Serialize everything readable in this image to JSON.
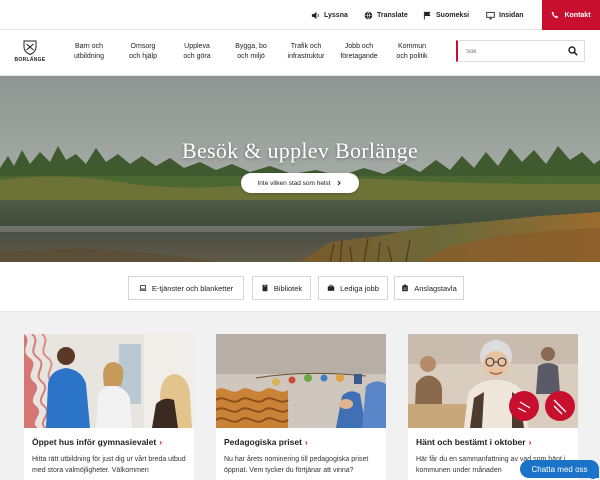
{
  "utility": {
    "listen": "Lyssna",
    "translate": "Translate",
    "finnish": "Suomeksi",
    "intranet": "Insidan",
    "contact": "Kontakt"
  },
  "brand": {
    "logo_text": "BORLÄNGE",
    "accent": "#c8102e"
  },
  "nav": [
    {
      "line1": "Barn och",
      "line2": "utbildning"
    },
    {
      "line1": "Omsorg",
      "line2": "och hjälp"
    },
    {
      "line1": "Uppleva",
      "line2": "och göra"
    },
    {
      "line1": "Bygga, bo",
      "line2": "och miljö"
    },
    {
      "line1": "Trafik och",
      "line2": "infrastruktur"
    },
    {
      "line1": "Jobb och",
      "line2": "företagande"
    },
    {
      "line1": "Kommun",
      "line2": "och politik"
    }
  ],
  "search": {
    "placeholder": "Sök"
  },
  "hero": {
    "title": "Besök & upplev Borlänge",
    "button": "Inte vilken stad som helst"
  },
  "quicklinks": [
    {
      "label": "E-tjänster och blanketter",
      "icon": "laptop-icon"
    },
    {
      "label": "Bibliotek",
      "icon": "book-icon"
    },
    {
      "label": "Lediga jobb",
      "icon": "briefcase-icon"
    },
    {
      "label": "Anslagstavla",
      "icon": "bulletin-icon"
    }
  ],
  "cards": [
    {
      "title": "Öppet hus inför gymnasievalet",
      "text": "Hitta rätt utbildning för just dig ur vårt breda utbud med stora valmöjligheter. Välkommen"
    },
    {
      "title": "Pedagogiska priset",
      "text": "Nu har årets nominering till pedagogiska priset öppnat. Vem tycker du förtjänar att vinna?"
    },
    {
      "title": "Hänt och bestämt i oktober",
      "text": "Här får du en sammanfattning av vad som hänt i kommunen under månaden"
    }
  ],
  "chat": {
    "label": "Chatta med oss"
  }
}
